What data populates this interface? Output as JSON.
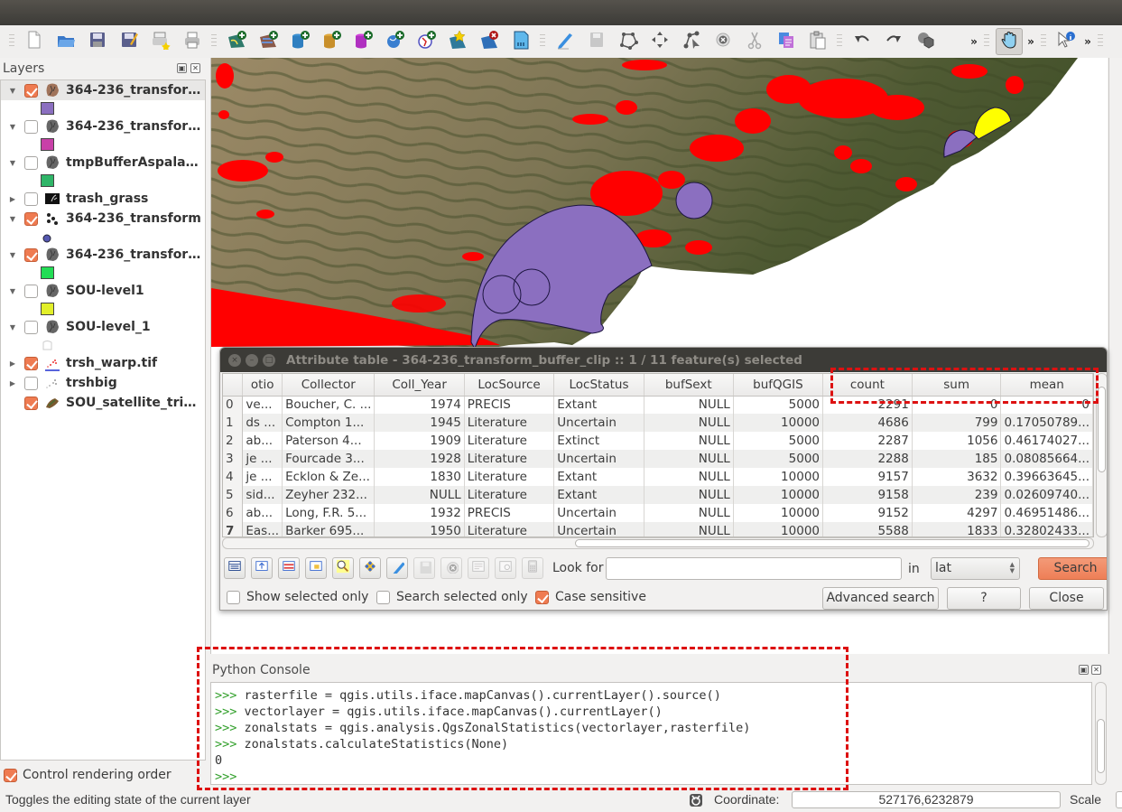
{
  "toolbar": {
    "buttons": [
      {
        "name": "new-project",
        "icon": "new-file-icon"
      },
      {
        "name": "open-project",
        "icon": "open-folder-icon"
      },
      {
        "name": "save-project",
        "icon": "save-icon"
      },
      {
        "name": "save-project-as",
        "icon": "save-as-icon"
      },
      {
        "name": "new-print-composer",
        "icon": "new-print-composer-icon"
      },
      {
        "name": "composer-manager",
        "icon": "printer-icon"
      },
      {
        "name": "add-vector-layer",
        "icon": "add-vector-icon"
      },
      {
        "name": "add-raster-layer",
        "icon": "add-raster-icon"
      },
      {
        "name": "add-postgis-layer",
        "icon": "add-database-blue-icon"
      },
      {
        "name": "add-spatialite-layer",
        "icon": "add-database-gold-icon"
      },
      {
        "name": "add-mssql-layer",
        "icon": "add-database-purple-icon"
      },
      {
        "name": "add-wms-layer",
        "icon": "add-wms-globe-icon"
      },
      {
        "name": "add-wfs-layer",
        "icon": "add-wfs-icon"
      },
      {
        "name": "new-shapefile-layer",
        "icon": "new-layer-star-icon"
      },
      {
        "name": "remove-layer",
        "icon": "remove-layer-icon"
      },
      {
        "name": "new-gpx-layer",
        "icon": "sd-card-icon"
      },
      {
        "name": "toggle-editing",
        "icon": "pencil-icon"
      },
      {
        "name": "save-edits",
        "icon": "save-edits-icon"
      },
      {
        "name": "add-feature",
        "icon": "polygon-nodes-icon"
      },
      {
        "name": "move-feature",
        "icon": "move-arrows-icon"
      },
      {
        "name": "node-tool",
        "icon": "node-tool-icon"
      },
      {
        "name": "delete-selected",
        "icon": "delete-circle-icon"
      },
      {
        "name": "cut-features",
        "icon": "scissors-icon"
      },
      {
        "name": "copy-features",
        "icon": "copy-icon"
      },
      {
        "name": "paste-features",
        "icon": "paste-icon"
      },
      {
        "name": "undo",
        "icon": "undo-icon"
      },
      {
        "name": "redo",
        "icon": "redo-icon"
      },
      {
        "name": "merge-features",
        "icon": "merge-shapes-icon"
      }
    ],
    "pan_tool": {
      "name": "pan-map",
      "icon": "pan-hand-icon",
      "active": true
    },
    "identify_tool": {
      "name": "identify-features",
      "icon": "identify-info-icon"
    },
    "overflow_label": "»"
  },
  "layers_panel": {
    "title": "Layers",
    "layers": [
      {
        "name": "364-236_transform...",
        "checked": true,
        "expanded": true,
        "type": "polygon",
        "icon_color": "#a0735a",
        "swatch": "#8b6fc0",
        "selected": true
      },
      {
        "name": "364-236_transform...",
        "checked": false,
        "expanded": true,
        "type": "polygon",
        "icon_color": "#666666",
        "swatch": "#c840a8"
      },
      {
        "name": "tmpBufferAspalath...",
        "checked": false,
        "expanded": true,
        "type": "polygon",
        "icon_color": "#666666",
        "swatch": "#2fb568"
      },
      {
        "name": "trash_grass",
        "checked": false,
        "expanded": false,
        "type": "raster"
      },
      {
        "name": "364-236_transform",
        "checked": true,
        "expanded": true,
        "type": "point",
        "swatch": "#5558b0",
        "swatch_shape": "dot"
      },
      {
        "name": "364-236_transform...",
        "checked": true,
        "expanded": true,
        "type": "polygon",
        "icon_color": "#666666",
        "swatch": "#22dd55"
      },
      {
        "name": "SOU-level1",
        "checked": false,
        "expanded": true,
        "type": "polygon",
        "icon_color": "#666666",
        "swatch": "#e2ef2a"
      },
      {
        "name": "SOU-level_1",
        "checked": false,
        "expanded": true,
        "type": "polygon",
        "icon_color": "#666666",
        "swatch": "#ffffff",
        "swatch_shape": "outline"
      },
      {
        "name": "trsh_warp.tif",
        "checked": true,
        "expanded": false,
        "type": "raster-red"
      },
      {
        "name": "trshbig",
        "checked": false,
        "expanded": false,
        "type": "raster-gray"
      },
      {
        "name": "SOU_satellite_trim...",
        "checked": true,
        "expanded": null,
        "type": "raster-satellite"
      }
    ],
    "control_rendering_order": {
      "label": "Control rendering order",
      "checked": true
    }
  },
  "attribute_table": {
    "title": "Attribute table - 364-236_transform_buffer_clip :: 1 / 11 feature(s) selected",
    "columns": [
      "otio",
      "Collector",
      "Coll_Year",
      "LocSource",
      "LocStatus",
      "bufSext",
      "bufQGIS",
      "count",
      "sum",
      "mean"
    ],
    "rows": [
      {
        "id": "0",
        "cells": [
          "ve...",
          "Boucher, C. ...",
          "1974",
          "PRECIS",
          "Extant",
          "NULL",
          "5000",
          "2291",
          "0",
          "0"
        ]
      },
      {
        "id": "1",
        "cells": [
          "ds ...",
          "Compton 1...",
          "1945",
          "Literature",
          "Uncertain",
          "NULL",
          "10000",
          "4686",
          "799",
          "0.17050789..."
        ]
      },
      {
        "id": "2",
        "cells": [
          "ab...",
          "Paterson 4...",
          "1909",
          "Literature",
          "Extinct",
          "NULL",
          "5000",
          "2287",
          "1056",
          "0.46174027..."
        ]
      },
      {
        "id": "3",
        "cells": [
          "je ...",
          "Fourcade 3...",
          "1928",
          "Literature",
          "Uncertain",
          "NULL",
          "5000",
          "2288",
          "185",
          "0.08085664..."
        ]
      },
      {
        "id": "4",
        "cells": [
          "je ...",
          "Ecklon & Ze...",
          "1830",
          "Literature",
          "Extant",
          "NULL",
          "10000",
          "9157",
          "3632",
          "0.39663645..."
        ]
      },
      {
        "id": "5",
        "cells": [
          "sid...",
          "Zeyher 232...",
          "NULL",
          "Literature",
          "Extant",
          "NULL",
          "10000",
          "9158",
          "239",
          "0.02609740..."
        ]
      },
      {
        "id": "6",
        "cells": [
          "ab...",
          "Long, F.R. 5...",
          "1932",
          "PRECIS",
          "Uncertain",
          "NULL",
          "10000",
          "9152",
          "4297",
          "0.46951486..."
        ]
      },
      {
        "id": "7",
        "cells": [
          "Eas...",
          "Barker 695...",
          "1950",
          "Literature",
          "Uncertain",
          "NULL",
          "10000",
          "5588",
          "1833",
          "0.32802433..."
        ]
      }
    ],
    "toolbar_buttons": [
      {
        "name": "unselect-all",
        "icon": "table-icon"
      },
      {
        "name": "move-selection-to-top",
        "icon": "move-selection-top-icon"
      },
      {
        "name": "invert-selection",
        "icon": "invert-selection-icon"
      },
      {
        "name": "pan-to-selected",
        "icon": "pan-to-selected-icon"
      },
      {
        "name": "zoom-to-selected",
        "icon": "magnifier-icon"
      },
      {
        "name": "select-by-expression",
        "icon": "select-expression-icon"
      },
      {
        "name": "toggle-editing",
        "icon": "pencil-icon"
      },
      {
        "name": "save-edits",
        "icon": "save-edits-icon",
        "disabled": true
      },
      {
        "name": "delete-selected",
        "icon": "delete-circle-icon",
        "disabled": true
      },
      {
        "name": "new-column",
        "icon": "new-column-icon",
        "disabled": true
      },
      {
        "name": "delete-column",
        "icon": "delete-column-icon",
        "disabled": true
      },
      {
        "name": "field-calculator",
        "icon": "calculator-icon",
        "disabled": true
      }
    ],
    "look_for_label": "Look for",
    "look_for_value": "",
    "in_label": "in",
    "field_selected": "lat",
    "search_label": "Search",
    "show_selected_only": {
      "label": "Show selected only",
      "checked": false
    },
    "search_selected_only": {
      "label": "Search selected only",
      "checked": false
    },
    "case_sensitive": {
      "label": "Case sensitive",
      "checked": true
    },
    "advanced_search_label": "Advanced search",
    "help_label": "?",
    "close_label": "Close"
  },
  "python_console": {
    "title": "Python Console",
    "lines": [
      {
        "prompt": ">>> ",
        "text": "rasterfile = qgis.utils.iface.mapCanvas().currentLayer().source()"
      },
      {
        "prompt": ">>> ",
        "text": "vectorlayer = qgis.utils.iface.mapCanvas().currentLayer()"
      },
      {
        "prompt": ">>> ",
        "text": "zonalstats = qgis.analysis.QgsZonalStatistics(vectorlayer,rasterfile)"
      },
      {
        "prompt": ">>> ",
        "text": "zonalstats.calculateStatistics(None)"
      },
      {
        "prompt": "",
        "text": "0"
      },
      {
        "prompt": ">>> ",
        "text": ""
      }
    ]
  },
  "statusbar": {
    "message": "Toggles the editing state of the current layer",
    "coordinate_label": "Coordinate:",
    "coordinate_value": "527176,6232879",
    "scale_label": "Scale"
  },
  "annotation_color": "#dd1111"
}
